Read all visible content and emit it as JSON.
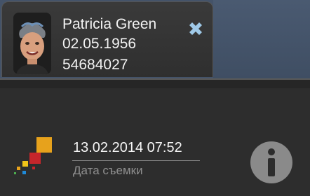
{
  "patient": {
    "name": "Patricia  Green",
    "dob": "02.05.1956",
    "id": "54684027"
  },
  "study": {
    "datetime": "13.02.2014 07:52",
    "datetime_label": "Дата съемки"
  },
  "icons": {
    "close": "close-x-icon",
    "info": "info-icon",
    "logo": "brand-logo"
  },
  "colors": {
    "topbar": "#445369",
    "close_icon": "#9fc9e8",
    "logo_orange": "#e7a21c",
    "logo_red": "#c6262b",
    "info_icon": "#8a8a8a"
  }
}
